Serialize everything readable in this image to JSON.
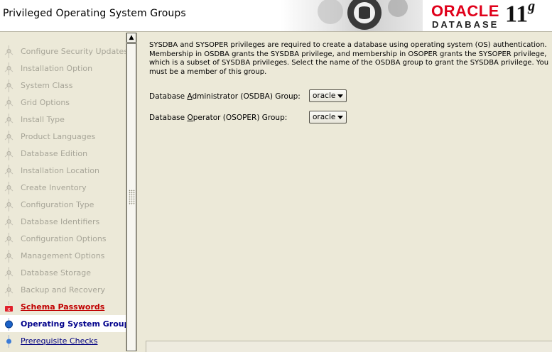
{
  "header": {
    "title": "Privileged Operating System Groups",
    "brand_oracle": "ORACLE",
    "brand_database": "DATABASE",
    "brand_version": "11",
    "brand_version_suffix": "g"
  },
  "sidebar": {
    "steps": [
      {
        "label": "Configure Security Updates",
        "state": "done"
      },
      {
        "label": "Installation Option",
        "state": "done"
      },
      {
        "label": "System Class",
        "state": "done"
      },
      {
        "label": "Grid Options",
        "state": "done"
      },
      {
        "label": "Install Type",
        "state": "done"
      },
      {
        "label": "Product Languages",
        "state": "done"
      },
      {
        "label": "Database Edition",
        "state": "done"
      },
      {
        "label": "Installation Location",
        "state": "done"
      },
      {
        "label": "Create Inventory",
        "state": "done"
      },
      {
        "label": "Configuration Type",
        "state": "done"
      },
      {
        "label": "Database Identifiers",
        "state": "done"
      },
      {
        "label": "Configuration Options",
        "state": "done"
      },
      {
        "label": "Management Options",
        "state": "done"
      },
      {
        "label": "Database Storage",
        "state": "done"
      },
      {
        "label": "Backup and Recovery",
        "state": "done"
      },
      {
        "label": "Schema Passwords",
        "state": "error"
      },
      {
        "label": "Operating System Groups",
        "state": "current"
      },
      {
        "label": "Prerequisite Checks",
        "state": "link"
      }
    ]
  },
  "content": {
    "description": "SYSDBA and SYSOPER privileges are required to create a database using operating system (OS) authentication. Membership in OSDBA grants the SYSDBA privilege, and membership in OSOPER grants the SYSOPER privilege, which is a subset of SYSDBA privileges. Select the name of the OSDBA group to grant the SYSDBA privilege. You must be a member of this group.",
    "osdba": {
      "label_pre": "Database ",
      "label_mnemonic": "A",
      "label_post": "dministrator (OSDBA) Group:",
      "value": "oracle"
    },
    "osoper": {
      "label_pre": "Database ",
      "label_mnemonic": "O",
      "label_post": "perator (OSOPER) Group:",
      "value": "oracle"
    }
  },
  "colors": {
    "brand_red": "#e0001a",
    "current_step_text": "#00008b",
    "error_step_text": "#c00000",
    "disabled_step_text": "#a7a598"
  }
}
